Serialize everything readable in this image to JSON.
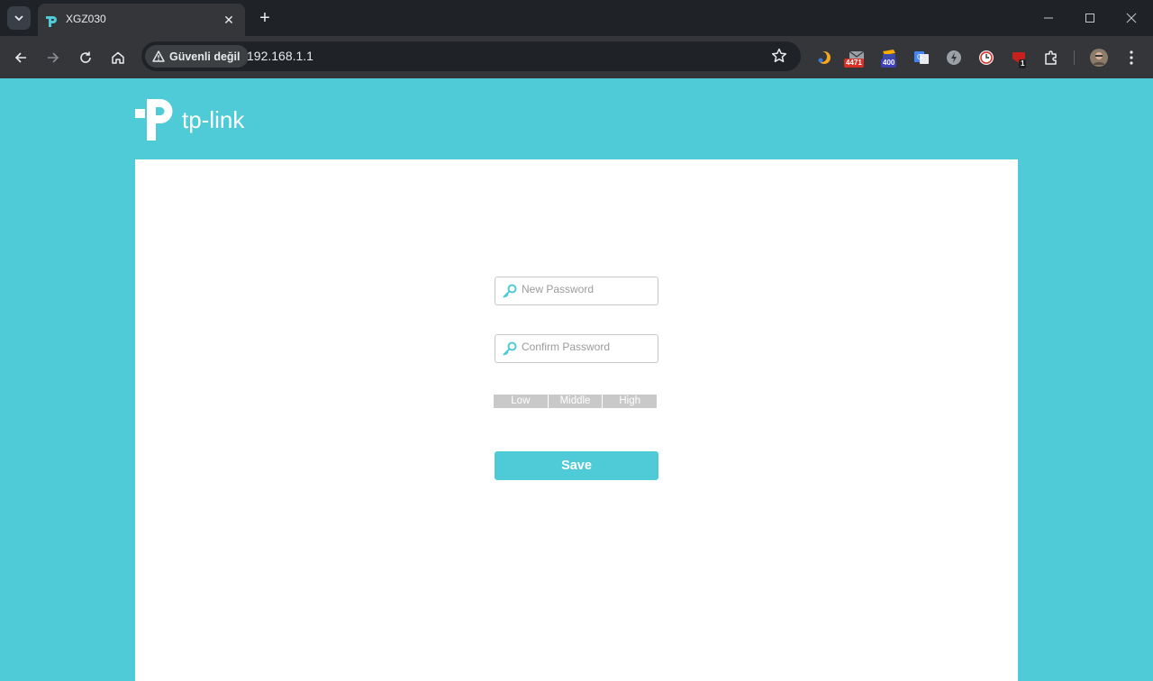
{
  "browser": {
    "tab": {
      "title": "XGZ030"
    },
    "security_label": "Güvenli değil",
    "url": "192.168.1.1",
    "extension_badges": {
      "mail": "4471",
      "counter": "400",
      "shield": "1"
    }
  },
  "logo_text": "tp-link",
  "form": {
    "new_password_placeholder": "New Password",
    "strength_levels": [
      "Low",
      "Middle",
      "High"
    ],
    "confirm_password_placeholder": "Confirm Password",
    "save_label": "Save"
  },
  "colors": {
    "brand": "#4ecbd6",
    "strength_bar": "#c9c9c9"
  }
}
